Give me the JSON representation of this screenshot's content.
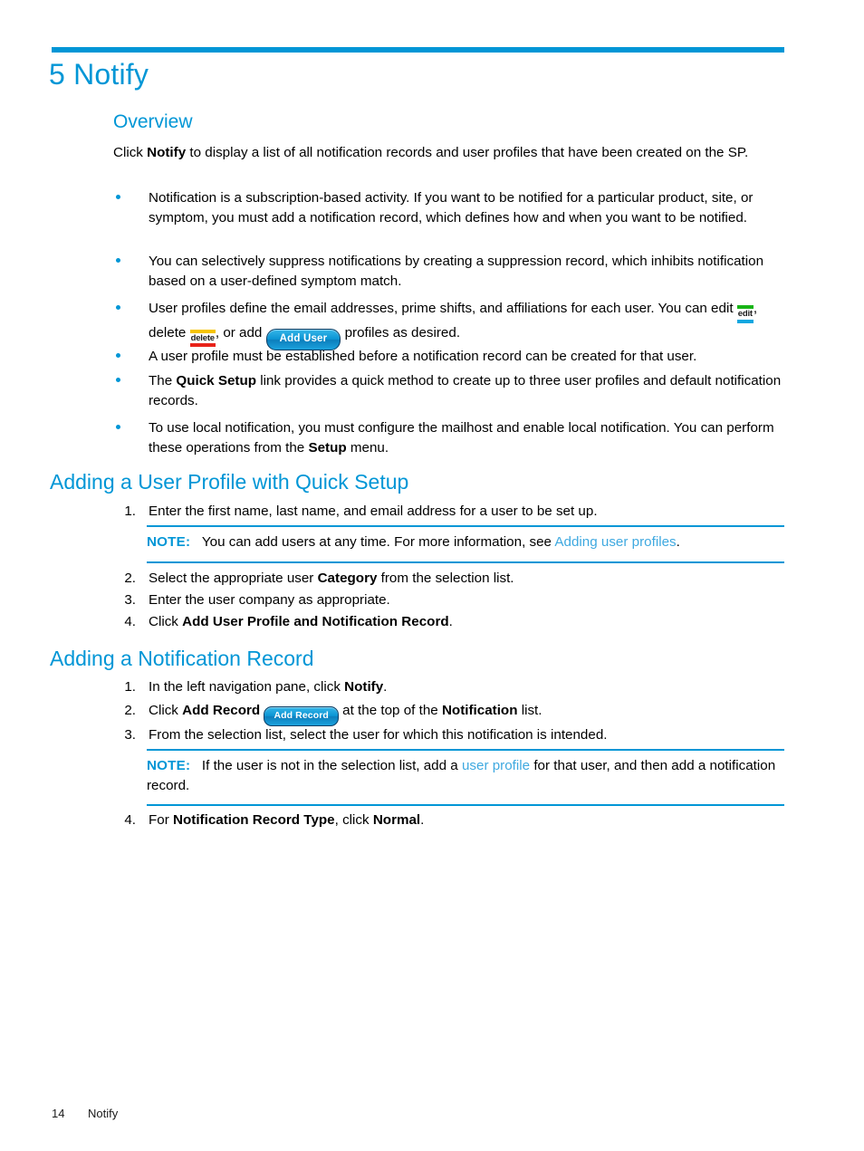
{
  "colors": {
    "accent": "#0096d6",
    "link": "#3fa9e0",
    "text": "#000000",
    "edit_bar_top": "#18b416",
    "edit_bar_bottom": "#0fa7e0",
    "delete_bar_top": "#f5c400",
    "delete_bar_bottom": "#e8231a",
    "button_blue": "#0b94d4"
  },
  "chapter": {
    "number": "5",
    "title": "5 Notify"
  },
  "overview": {
    "heading": "Overview",
    "intro_pre": "Click ",
    "intro_bold": "Notify",
    "intro_post": " to display a list of all notification records and user profiles that have been created on the SP.",
    "bullets": [
      {
        "id": "bullet-subscription",
        "text": "Notification is a subscription-based activity. If you want to be notified for a particular product, site, or symptom, you must add a notification record, which defines how and when you want to be notified."
      },
      {
        "id": "bullet-suppression",
        "text": "You can selectively suppress notifications by creating a suppression record, which inhibits notification based on a user-defined symptom match."
      },
      {
        "id": "bullet-user-profiles",
        "segments": {
          "lead": "User profiles define the email addresses, prime shifts, and affiliations for each user. You can edit ",
          "mid1": ", delete ",
          "mid2": ", or add ",
          "tail": " profiles as desired."
        }
      },
      {
        "id": "bullet-profile-required",
        "text": "A user profile must be established before a notification record can be created for that user."
      },
      {
        "id": "bullet-quick-setup",
        "pre": "The ",
        "bold": "Quick Setup",
        "post": " link provides a quick method to create up to three user profiles and default notification records."
      },
      {
        "id": "bullet-local-notification",
        "pre": "To use local notification, you must configure the mailhost and enable local notification. You can perform these operations from the ",
        "bold": "Setup",
        "post": " menu."
      }
    ]
  },
  "icons": {
    "edit_label": "edit",
    "delete_label": "delete",
    "add_user_label": "Add User",
    "add_record_label": "Add Record"
  },
  "quick_setup_section": {
    "heading": "Adding a User Profile with Quick Setup",
    "steps": [
      {
        "num": "1.",
        "text": "Enter the first name, last name, and email address for a user to be set up."
      },
      {
        "num": "2.",
        "pre": "Select the appropriate user ",
        "bold": "Category",
        "post": " from the selection list."
      },
      {
        "num": "3.",
        "text": "Enter the user company as appropriate."
      },
      {
        "num": "4.",
        "pre": "Click ",
        "bold": "Add User Profile and Notification Record",
        "post": "."
      }
    ],
    "note": {
      "label": "NOTE:",
      "pre": "You can add users at any time. For more information, see ",
      "link": "Adding user profiles",
      "post": "."
    }
  },
  "notification_section": {
    "heading": "Adding a Notification Record",
    "steps": [
      {
        "num": "1.",
        "pre": "In the left navigation pane, click ",
        "bold": "Notify",
        "post": "."
      },
      {
        "num": "2.",
        "pre": "Click ",
        "bold": "Add Record",
        "mid": " at the top of the ",
        "bold2": "Notification",
        "post": " list."
      },
      {
        "num": "3.",
        "text": "From the selection list, select the user for which this notification is intended."
      },
      {
        "num": "4.",
        "pre": "For ",
        "bold": "Notification Record Type",
        "mid": ", click ",
        "bold2": "Normal",
        "post": "."
      }
    ],
    "note": {
      "label": "NOTE:",
      "pre": "If the user is not in the selection list, add a ",
      "link": "user profile",
      "post": " for that user, and then add a notification record."
    }
  },
  "footer": {
    "page_number": "14",
    "section_name": "Notify"
  }
}
